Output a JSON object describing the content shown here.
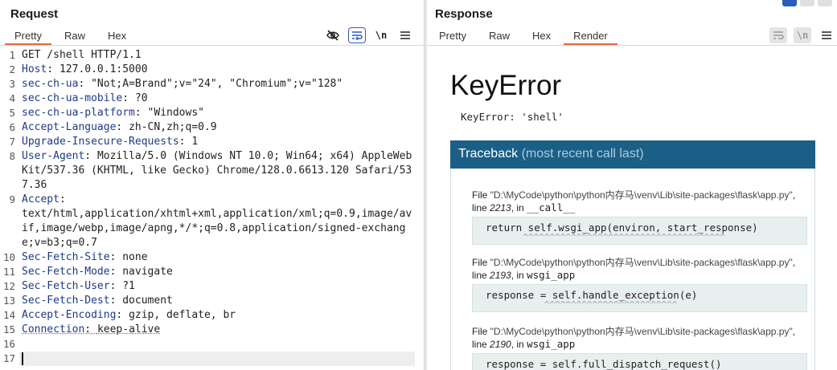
{
  "request": {
    "title": "Request",
    "tabs": [
      {
        "label": "Pretty",
        "active": true
      },
      {
        "label": "Raw",
        "active": false
      },
      {
        "label": "Hex",
        "active": false
      }
    ],
    "toolbar": {
      "hide_icon": "eye-slash-icon",
      "wrap_icon": "wrap-lines-icon",
      "newline_label": "\\n",
      "menu_icon": "hamburger-menu-icon"
    },
    "lines": [
      {
        "n": "1",
        "key": "",
        "sep": "",
        "val": "GET /shell HTTP/1.1"
      },
      {
        "n": "2",
        "key": "Host",
        "sep": ": ",
        "val": "127.0.0.1:5000"
      },
      {
        "n": "3",
        "key": "sec-ch-ua",
        "sep": ": ",
        "val": "\"Not;A=Brand\";v=\"24\", \"Chromium\";v=\"128\""
      },
      {
        "n": "4",
        "key": "sec-ch-ua-mobile",
        "sep": ": ",
        "val": "?0"
      },
      {
        "n": "5",
        "key": "sec-ch-ua-platform",
        "sep": ": ",
        "val": "\"Windows\""
      },
      {
        "n": "6",
        "key": "Accept-Language",
        "sep": ": ",
        "val": "zh-CN,zh;q=0.9"
      },
      {
        "n": "7",
        "key": "Upgrade-Insecure-Requests",
        "sep": ": ",
        "val": "1"
      },
      {
        "n": "8",
        "key": "User-Agent",
        "sep": ": ",
        "val": "Mozilla/5.0 (Windows NT 10.0; Win64; x64) AppleWebKit/537.36 (KHTML, like Gecko) Chrome/128.0.6613.120 Safari/537.36"
      },
      {
        "n": "9",
        "key": "Accept",
        "sep": ":",
        "val": "text/html,application/xhtml+xml,application/xml;q=0.9,image/avif,image/webp,image/apng,*/*;q=0.8,application/signed-exchange;v=b3;q=0.7"
      },
      {
        "n": "10",
        "key": "Sec-Fetch-Site",
        "sep": ": ",
        "val": "none"
      },
      {
        "n": "11",
        "key": "Sec-Fetch-Mode",
        "sep": ": ",
        "val": "navigate"
      },
      {
        "n": "12",
        "key": "Sec-Fetch-User",
        "sep": ": ",
        "val": "?1"
      },
      {
        "n": "13",
        "key": "Sec-Fetch-Dest",
        "sep": ": ",
        "val": "document"
      },
      {
        "n": "14",
        "key": "Accept-Encoding",
        "sep": ": ",
        "val": "gzip, deflate, br"
      },
      {
        "n": "15",
        "key": "Connection",
        "sep": ": ",
        "val": "keep-alive"
      },
      {
        "n": "16",
        "key": "",
        "sep": "",
        "val": ""
      },
      {
        "n": "17",
        "key": "",
        "sep": "",
        "val": ""
      }
    ]
  },
  "response": {
    "title": "Response",
    "tabs": [
      {
        "label": "Pretty",
        "active": false
      },
      {
        "label": "Raw",
        "active": false
      },
      {
        "label": "Hex",
        "active": false
      },
      {
        "label": "Render",
        "active": true
      }
    ],
    "toolbar": {
      "wrap_icon": "wrap-lines-icon",
      "newline_label": "\\n",
      "menu_icon": "hamburger-menu-icon"
    },
    "render": {
      "error_title": "KeyError",
      "error_message": "KeyError: 'shell'",
      "traceback_label": "Traceback",
      "traceback_sub": "(most recent call last)",
      "frames": [
        {
          "file_prefix": "File ",
          "path": "\"D:\\MyCode\\python\\python内存马\\venv\\Lib\\site-packages\\flask\\app.py\"",
          "line_prefix": ", line ",
          "line_no": "2213",
          "in_prefix": ", in ",
          "func": "__call__",
          "code": "return self.wsgi_app(environ, start_response)",
          "carets": "       ^^^^^^^^^^^^^^^^^^^^^^^^^^^^^^^^^^^^^^"
        },
        {
          "file_prefix": "File ",
          "path": "\"D:\\MyCode\\python\\python内存马\\venv\\Lib\\site-packages\\flask\\app.py\"",
          "line_prefix": ", line ",
          "line_no": "2193",
          "in_prefix": ", in ",
          "func": "wsgi_app",
          "code": "response = self.handle_exception(e)",
          "carets": "           ^^^^^^^^^^^^^^^^^^^^^^^^^"
        },
        {
          "file_prefix": "File ",
          "path": "\"D:\\MyCode\\python\\python内存马\\venv\\Lib\\site-packages\\flask\\app.py\"",
          "line_prefix": ", line ",
          "line_no": "2190",
          "in_prefix": ", in ",
          "func": "wsgi_app",
          "code": "response = self.full_dispatch_request()",
          "carets": ""
        }
      ]
    }
  },
  "colors": {
    "accent": "#e8673c",
    "traceback_header": "#1c5f86",
    "header_key": "#1e3a8a"
  }
}
